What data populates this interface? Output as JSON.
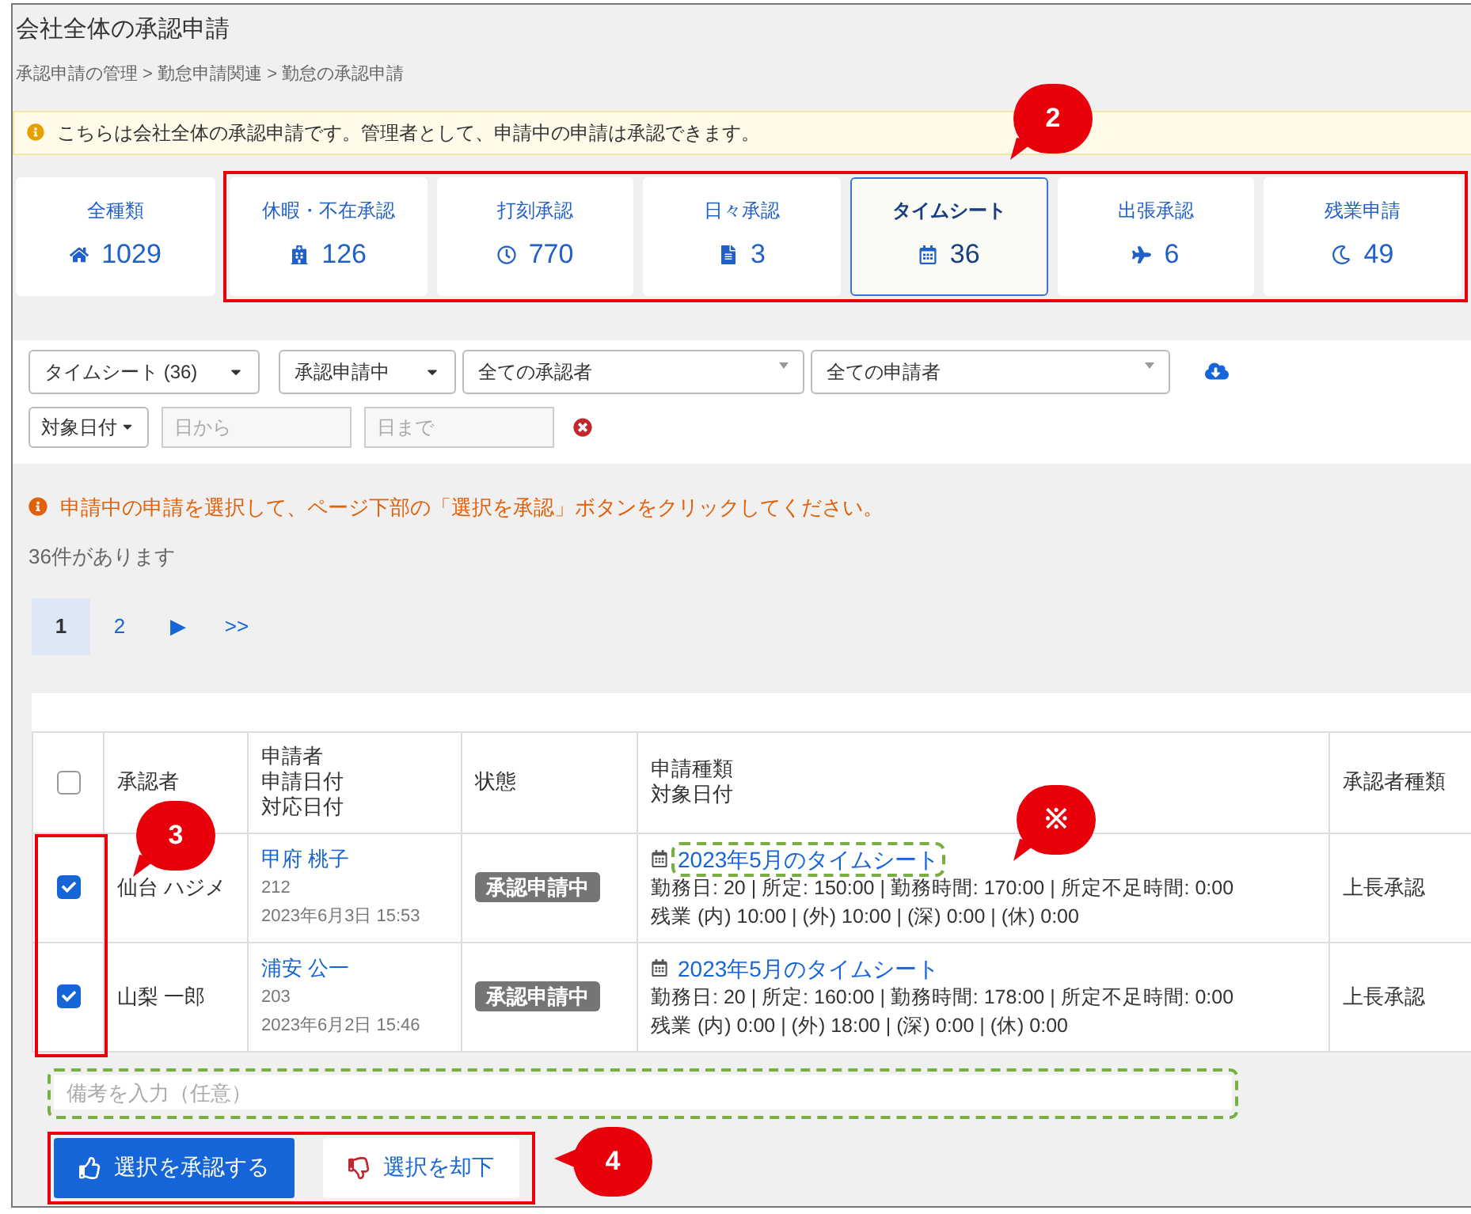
{
  "page": {
    "title": "会社全体の承認申請",
    "breadcrumb": "承認申請の管理 > 勤怠申請関連 > 勤怠の承認申請"
  },
  "notice": "こちらは会社全体の承認申請です。管理者として、申請中の申請は承認できます。",
  "categories": [
    {
      "label": "全種類",
      "count": "1029",
      "selected": false
    },
    {
      "label": "休暇・不在承認",
      "count": "126",
      "selected": false
    },
    {
      "label": "打刻承認",
      "count": "770",
      "selected": false
    },
    {
      "label": "日々承認",
      "count": "3",
      "selected": false
    },
    {
      "label": "タイムシート",
      "count": "36",
      "selected": true
    },
    {
      "label": "出張承認",
      "count": "6",
      "selected": false
    },
    {
      "label": "残業申請",
      "count": "49",
      "selected": false
    }
  ],
  "filters": {
    "type_select": "タイムシート (36)",
    "status_select": "承認申請中",
    "approver_select": "全ての承認者",
    "applicant_select": "全ての申請者",
    "date_select": "対象日付",
    "from_placeholder": "日から",
    "to_placeholder": "日まで"
  },
  "instruction": "申請中の申請を選択して、ページ下部の「選択を承認」ボタンをクリックしてください。",
  "result_count": "36件があります",
  "pagination": [
    {
      "label": "1",
      "selected": true
    },
    {
      "label": "2",
      "selected": false
    },
    {
      "label": "▶",
      "selected": false
    },
    {
      "label": ">>",
      "selected": false
    }
  ],
  "table": {
    "select_all": {
      "checked": false
    },
    "columns": [
      [
        "承認者"
      ],
      [
        "申請者",
        "申請日付",
        "対応日付"
      ],
      [
        "状態"
      ],
      [
        "申請種類",
        "対象日付"
      ],
      [
        "承認者種類"
      ]
    ],
    "rows": [
      {
        "checked": true,
        "approver": "仙台 ハジメ",
        "applicant": "甲府 桃子",
        "applicant_id": "212",
        "applied_at": "2023年6月3日 15:53",
        "status": "承認申請中",
        "request": "2023年5月のタイムシート",
        "details": [
          "勤務日: 20 | 所定: 150:00 | 勤務時間: 170:00 | 所定不足時間: 0:00",
          "残業 (内) 10:00 | (外) 10:00 | (深) 0:00 | (休) 0:00"
        ],
        "approver_type": "上長承認"
      },
      {
        "checked": true,
        "approver": "山梨 一郎",
        "applicant": "浦安 公一",
        "applicant_id": "203",
        "applied_at": "2023年6月2日 15:46",
        "status": "承認申請中",
        "request": "2023年5月のタイムシート",
        "details": [
          "勤務日: 20 | 所定: 160:00 | 勤務時間: 178:00 | 所定不足時間: 0:00",
          "残業 (内) 0:00 | (外) 18:00 | (深) 0:00 | (休) 0:00"
        ],
        "approver_type": "上長承認"
      }
    ]
  },
  "remark": {
    "placeholder": "備考を入力（任意）"
  },
  "buttons": [
    {
      "label": "選択を承認する",
      "kind": "primary"
    },
    {
      "label": "選択を却下",
      "kind": "secondary"
    }
  ],
  "callouts": [
    "2",
    "3",
    "※",
    "4"
  ]
}
